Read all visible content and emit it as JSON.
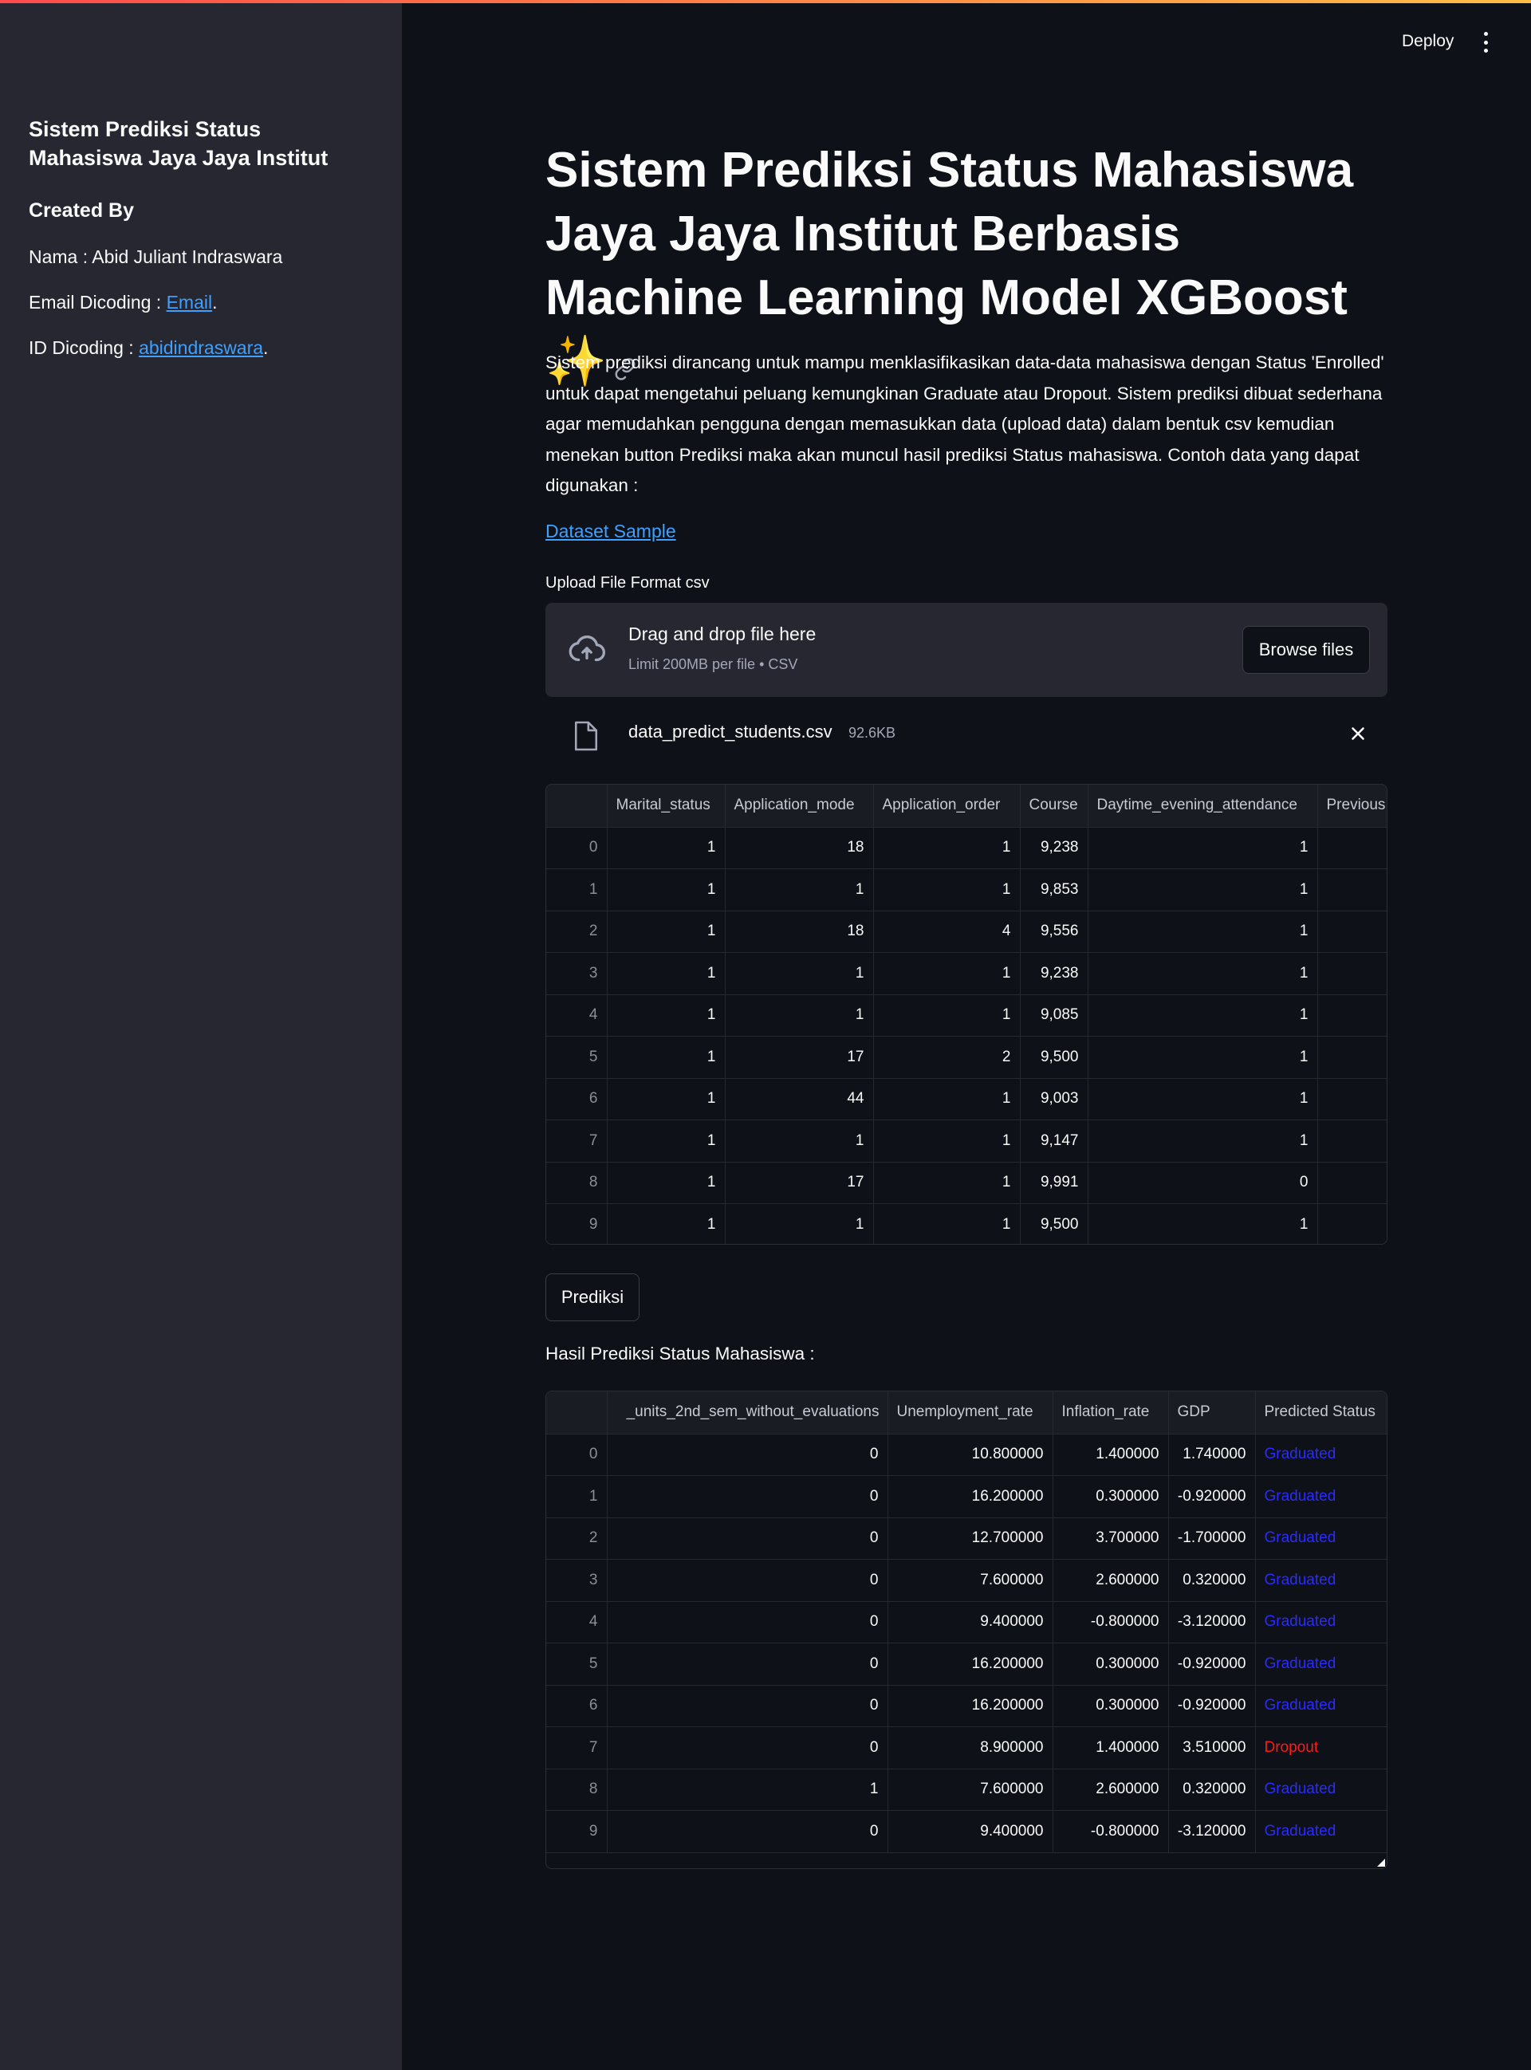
{
  "sidebar": {
    "title": "Sistem Prediksi Status Mahasiswa Jaya Jaya Institut",
    "created_by": "Created By",
    "nama": "Nama : Abid Juliant Indraswara",
    "email_prefix": "Email Dicoding : ",
    "email_link": "Email",
    "id_prefix": "ID Dicoding : ",
    "id_link": "abidindraswara",
    "period": "."
  },
  "header": {
    "deploy_label": "Deploy",
    "menu_icon": "kebab-menu-icon"
  },
  "main": {
    "title": "Sistem Prediksi Status Mahasiswa Jaya Jaya Institut Berbasis Machine Learning Model XGBoost ✨",
    "description": "Sistem prediksi dirancang untuk mampu menklasifikasikan data-data mahasiswa dengan Status 'Enrolled' untuk dapat mengetahui peluang kemungkinan Graduate atau Dropout. Sistem prediksi dibuat sederhana agar memudahkan pengguna dengan memasukkan data (upload data) dalam bentuk csv kemudian menekan button Prediksi maka akan muncul hasil prediksi Status mahasiswa. Contoh data yang dapat digunakan :",
    "dataset_link": "Dataset Sample",
    "upload_label": "Upload File Format csv",
    "dropzone": {
      "main_text": "Drag and drop file here",
      "sub_text": "Limit 200MB per file • CSV",
      "browse_label": "Browse files"
    },
    "uploaded_file": {
      "name": "data_predict_students.csv",
      "size": "92.6KB"
    },
    "input_table": {
      "columns": [
        "Marital_status",
        "Application_mode",
        "Application_order",
        "Course",
        "Daytime_evening_attendance",
        "Previous"
      ],
      "rows": [
        [
          "0",
          "1",
          "18",
          "1",
          "9,238",
          "1",
          ""
        ],
        [
          "1",
          "1",
          "1",
          "1",
          "9,853",
          "1",
          ""
        ],
        [
          "2",
          "1",
          "18",
          "4",
          "9,556",
          "1",
          ""
        ],
        [
          "3",
          "1",
          "1",
          "1",
          "9,238",
          "1",
          ""
        ],
        [
          "4",
          "1",
          "1",
          "1",
          "9,085",
          "1",
          ""
        ],
        [
          "5",
          "1",
          "17",
          "2",
          "9,500",
          "1",
          ""
        ],
        [
          "6",
          "1",
          "44",
          "1",
          "9,003",
          "1",
          ""
        ],
        [
          "7",
          "1",
          "1",
          "1",
          "9,147",
          "1",
          ""
        ],
        [
          "8",
          "1",
          "17",
          "1",
          "9,991",
          "0",
          ""
        ],
        [
          "9",
          "1",
          "1",
          "1",
          "9,500",
          "1",
          ""
        ]
      ]
    },
    "predict_button": "Prediksi",
    "result_label": "Hasil Prediksi Status Mahasiswa :",
    "result_table": {
      "columns": [
        "_units_2nd_sem_without_evaluations",
        "Unemployment_rate",
        "Inflation_rate",
        "GDP",
        "Predicted Status"
      ],
      "rows": [
        [
          "0",
          "0",
          "10.800000",
          "1.400000",
          "1.740000",
          "Graduated"
        ],
        [
          "1",
          "0",
          "16.200000",
          "0.300000",
          "-0.920000",
          "Graduated"
        ],
        [
          "2",
          "0",
          "12.700000",
          "3.700000",
          "-1.700000",
          "Graduated"
        ],
        [
          "3",
          "0",
          "7.600000",
          "2.600000",
          "0.320000",
          "Graduated"
        ],
        [
          "4",
          "0",
          "9.400000",
          "-0.800000",
          "-3.120000",
          "Graduated"
        ],
        [
          "5",
          "0",
          "16.200000",
          "0.300000",
          "-0.920000",
          "Graduated"
        ],
        [
          "6",
          "0",
          "16.200000",
          "0.300000",
          "-0.920000",
          "Graduated"
        ],
        [
          "7",
          "0",
          "8.900000",
          "1.400000",
          "3.510000",
          "Dropout"
        ],
        [
          "8",
          "1",
          "7.600000",
          "2.600000",
          "0.320000",
          "Graduated"
        ],
        [
          "9",
          "0",
          "9.400000",
          "-0.800000",
          "-3.120000",
          "Graduated"
        ]
      ]
    }
  },
  "colors": {
    "background": "#0e1117",
    "sidebar": "#262730",
    "link": "#3ea0ff",
    "graduated": "#2b2bff",
    "dropout": "#ff1a1a",
    "accent_gradient_start": "#ff4b4b",
    "accent_gradient_end": "#ffbd45"
  }
}
